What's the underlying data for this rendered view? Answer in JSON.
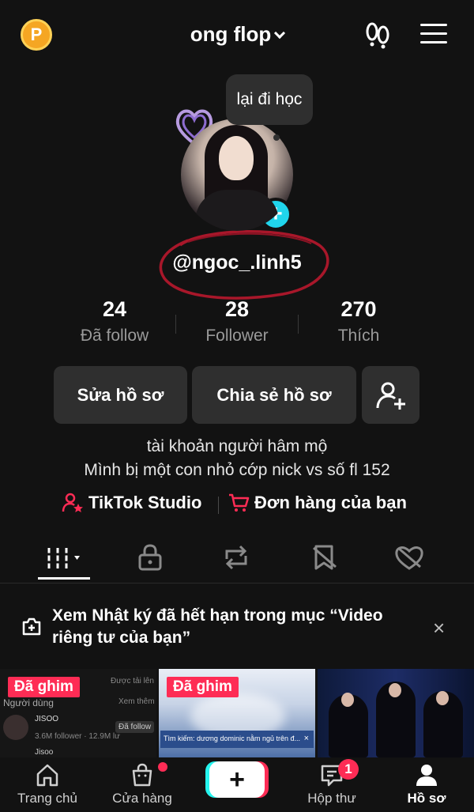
{
  "header": {
    "coin_label": "P",
    "title": "ong flop"
  },
  "profile": {
    "status_bubble": "lại đi học",
    "handle": "@ngoc_.linh5",
    "stats": [
      {
        "value": "24",
        "label": "Đã follow"
      },
      {
        "value": "28",
        "label": "Follower"
      },
      {
        "value": "270",
        "label": "Thích"
      }
    ],
    "buttons": {
      "edit": "Sửa hồ sơ",
      "share": "Chia sẻ hồ sơ"
    },
    "bio": [
      "tài khoản người hâm mộ",
      "Mình bị một con nhỏ cớp nick vs số fl 152"
    ],
    "links": {
      "studio": "TikTok Studio",
      "orders": "Đơn hàng của bạn"
    }
  },
  "notice": {
    "text": "Xem Nhật ký đã hết hạn trong mục “Video riêng tư của bạn”",
    "close": "×"
  },
  "videos": [
    {
      "pinned_label": "Đã ghim",
      "thumb_texts": [
        "Được tải lên",
        "Người dùng",
        "Xem thêm",
        "JISOO",
        "Đã follow",
        "3.6M follower · 12.9M lư",
        "Jisoo"
      ]
    },
    {
      "pinned_label": "Đã ghim",
      "search_text": "Tìm kiếm: dương dominic nằm ngủ trên đ...",
      "search_close": "×"
    },
    {}
  ],
  "bottom_nav": {
    "home": "Trang chủ",
    "shop": "Cửa hàng",
    "create": "+",
    "inbox": "Hộp thư",
    "inbox_badge": "1",
    "profile": "Hồ sơ"
  },
  "colors": {
    "background": "#121212",
    "accent_red": "#fe2c55",
    "accent_cyan": "#25f4ee",
    "plus_badge": "#20d5ec",
    "coin": "#f5a623",
    "scribble": "#a8172a"
  }
}
